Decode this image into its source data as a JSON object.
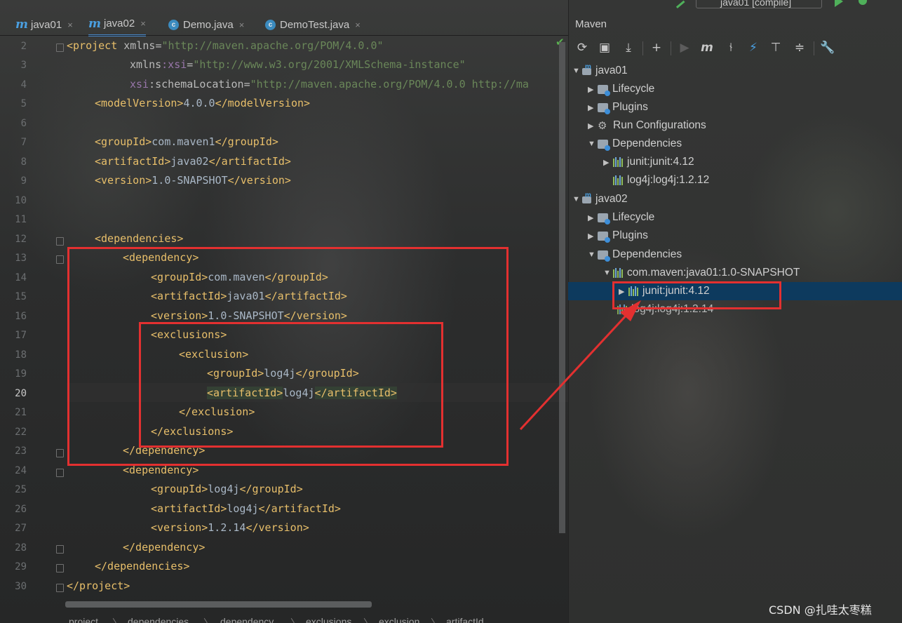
{
  "tabs": [
    {
      "label": "java01",
      "icon": "maven-m-icon"
    },
    {
      "label": "java02",
      "icon": "maven-m-icon"
    },
    {
      "label": "Demo.java",
      "icon": "class-c-icon"
    },
    {
      "label": "DemoTest.java",
      "icon": "class-c-icon"
    }
  ],
  "close_glyph": "×",
  "line_numbers": [
    "2",
    "3",
    "4",
    "5",
    "6",
    "7",
    "8",
    "9",
    "10",
    "11",
    "12",
    "13",
    "14",
    "15",
    "16",
    "17",
    "18",
    "19",
    "20",
    "21",
    "22",
    "23",
    "24",
    "25",
    "26",
    "27",
    "28",
    "29",
    "30"
  ],
  "code": {
    "l2": {
      "tag_open": "<project",
      "attr": " xmlns",
      "eq": "=",
      "val": "\"http://maven.apache.org/POM/4.0.0\""
    },
    "l3": {
      "attr": "xmlns",
      "ns": ":xsi",
      "eq": "=",
      "val": "\"http://www.w3.org/2001/XMLSchema-instance\""
    },
    "l4": {
      "ns": "xsi",
      "attr": ":schemaLocation",
      "eq": "=",
      "val": "\"http://maven.apache.org/POM/4.0.0 http://ma"
    },
    "l5": {
      "open": "<modelVersion>",
      "text": "4.0.0",
      "close": "</modelVersion>"
    },
    "l7": {
      "open": "<groupId>",
      "text": "com.maven1",
      "close": "</groupId>"
    },
    "l8": {
      "open": "<artifactId>",
      "text": "java02",
      "close": "</artifactId>"
    },
    "l9": {
      "open": "<version>",
      "text": "1.0-SNAPSHOT",
      "close": "</version>"
    },
    "l12": {
      "open": "<dependencies>"
    },
    "l13": {
      "open": "<dependency>"
    },
    "l14": {
      "open": "<groupId>",
      "text": "com.maven",
      "close": "</groupId>"
    },
    "l15": {
      "open": "<artifactId>",
      "text": "java01",
      "close": "</artifactId>"
    },
    "l16": {
      "open": "<version>",
      "text": "1.0-SNAPSHOT",
      "close": "</version>"
    },
    "l17": {
      "open": "<exclusions>"
    },
    "l18": {
      "open": "<exclusion>"
    },
    "l19": {
      "open": "<groupId>",
      "text": "log4j",
      "close": "</groupId>"
    },
    "l20": {
      "open": "<artifactId>",
      "text": "log4j",
      "close": "</artifactId>"
    },
    "l21": {
      "open": "</exclusion>"
    },
    "l22": {
      "open": "</exclusions>"
    },
    "l23": {
      "open": "</dependency>"
    },
    "l24": {
      "open": "<dependency>"
    },
    "l25": {
      "open": "<groupId>",
      "text": "log4j",
      "close": "</groupId>"
    },
    "l26": {
      "open": "<artifactId>",
      "text": "log4j",
      "close": "</artifactId>"
    },
    "l27": {
      "open": "<version>",
      "text": "1.2.14",
      "close": "</version>"
    },
    "l28": {
      "open": "</dependency>"
    },
    "l29": {
      "open": "</dependencies>"
    },
    "l30": {
      "open": "</project>"
    }
  },
  "breadcrumb": [
    "project",
    "dependencies",
    "dependency",
    "exclusions",
    "exclusion",
    "artifactId"
  ],
  "breadcrumb_sep": "〉",
  "run_config": "java01 [compile]",
  "maven": {
    "title": "Maven",
    "toolbar": [
      "reload-icon",
      "generate-sources-icon",
      "download-icon",
      "add-icon",
      "run-icon",
      "execute-goal-icon",
      "toggle-offline-icon",
      "skip-tests-icon",
      "show-dependencies-icon",
      "collapse-all-icon",
      "settings-wrench-icon"
    ],
    "tree": [
      {
        "label": "java01",
        "arrow": "▼"
      },
      {
        "label": "Lifecycle",
        "arrow": "▶"
      },
      {
        "label": "Plugins",
        "arrow": "▶"
      },
      {
        "label": "Run Configurations",
        "arrow": "▶"
      },
      {
        "label": "Dependencies",
        "arrow": "▼"
      },
      {
        "label": "junit:junit:4.12",
        "arrow": "▶"
      },
      {
        "label": "log4j:log4j:1.2.12",
        "arrow": ""
      },
      {
        "label": "java02",
        "arrow": "▼"
      },
      {
        "label": "Lifecycle",
        "arrow": "▶"
      },
      {
        "label": "Plugins",
        "arrow": "▶"
      },
      {
        "label": "Dependencies",
        "arrow": "▼"
      },
      {
        "label": "com.maven:java01:1.0-SNAPSHOT",
        "arrow": "▼"
      },
      {
        "label": "junit:junit:4.12",
        "arrow": "▶"
      },
      {
        "label": "log4j:log4j:1.2.14",
        "arrow": ""
      }
    ]
  },
  "watermark": "CSDN @扎哇太枣糕",
  "colors": {
    "annotation": "#e33030",
    "selection": "#0d3a5e",
    "tag": "#e8bf6a",
    "value": "#6a8759"
  }
}
